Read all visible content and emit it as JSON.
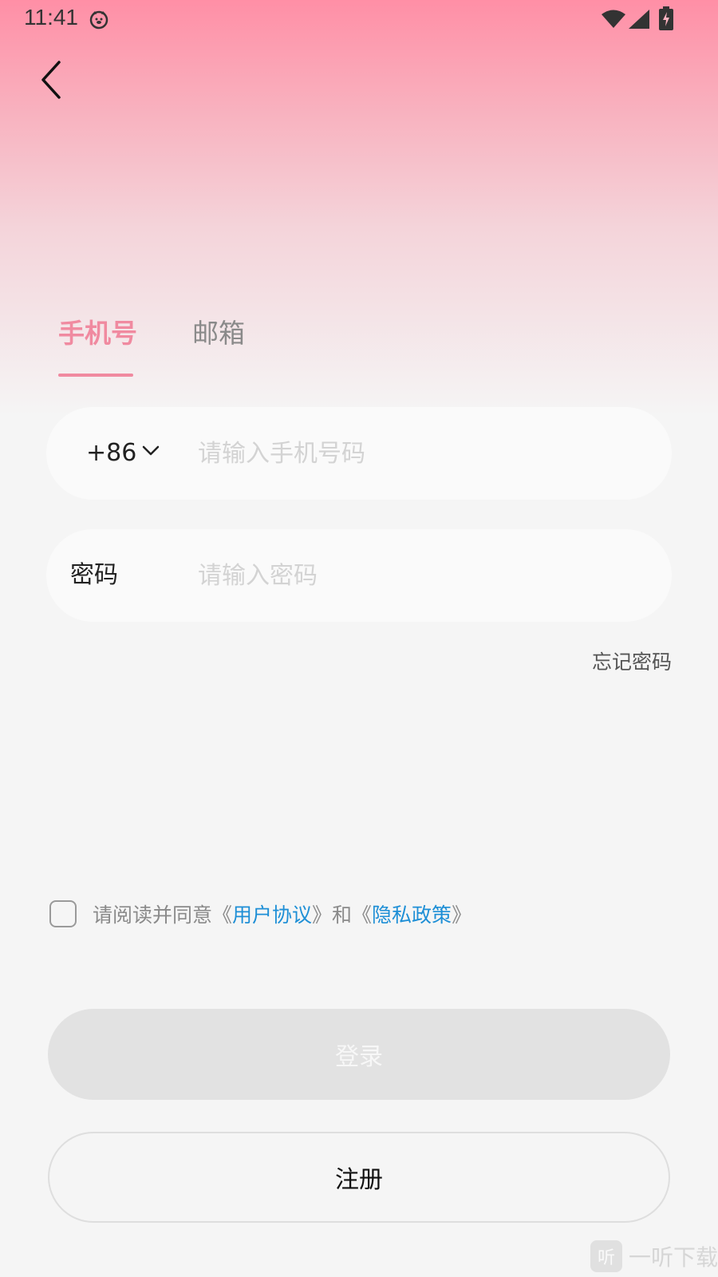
{
  "status_bar": {
    "time": "11:41",
    "icons": [
      "app-notification-icon",
      "wifi-icon",
      "signal-icon",
      "battery-charging-icon"
    ]
  },
  "nav": {
    "back_icon": "chevron-left-icon"
  },
  "tabs": [
    {
      "label": "手机号",
      "active": true
    },
    {
      "label": "邮箱",
      "active": false
    }
  ],
  "phone_field": {
    "country_code": "+86",
    "placeholder": "请输入手机号码",
    "value": ""
  },
  "password_field": {
    "label": "密码",
    "placeholder": "请输入密码",
    "value": ""
  },
  "forgot_password": "忘记密码",
  "agreement": {
    "checked": false,
    "prefix": "请阅读并同意《",
    "user_agreement": "用户协议",
    "middle": "》和《",
    "privacy_policy": "隐私政策",
    "suffix": "》"
  },
  "buttons": {
    "login": "登录",
    "register": "注册"
  },
  "watermark": {
    "icon_glyph": "听",
    "text": "一听下载"
  },
  "colors": {
    "accent": "#f08aa0",
    "link": "#1e8fd6",
    "gradient_top": "#ff8fa6",
    "background": "#f5f5f5",
    "login_disabled": "#e2e2e2"
  }
}
